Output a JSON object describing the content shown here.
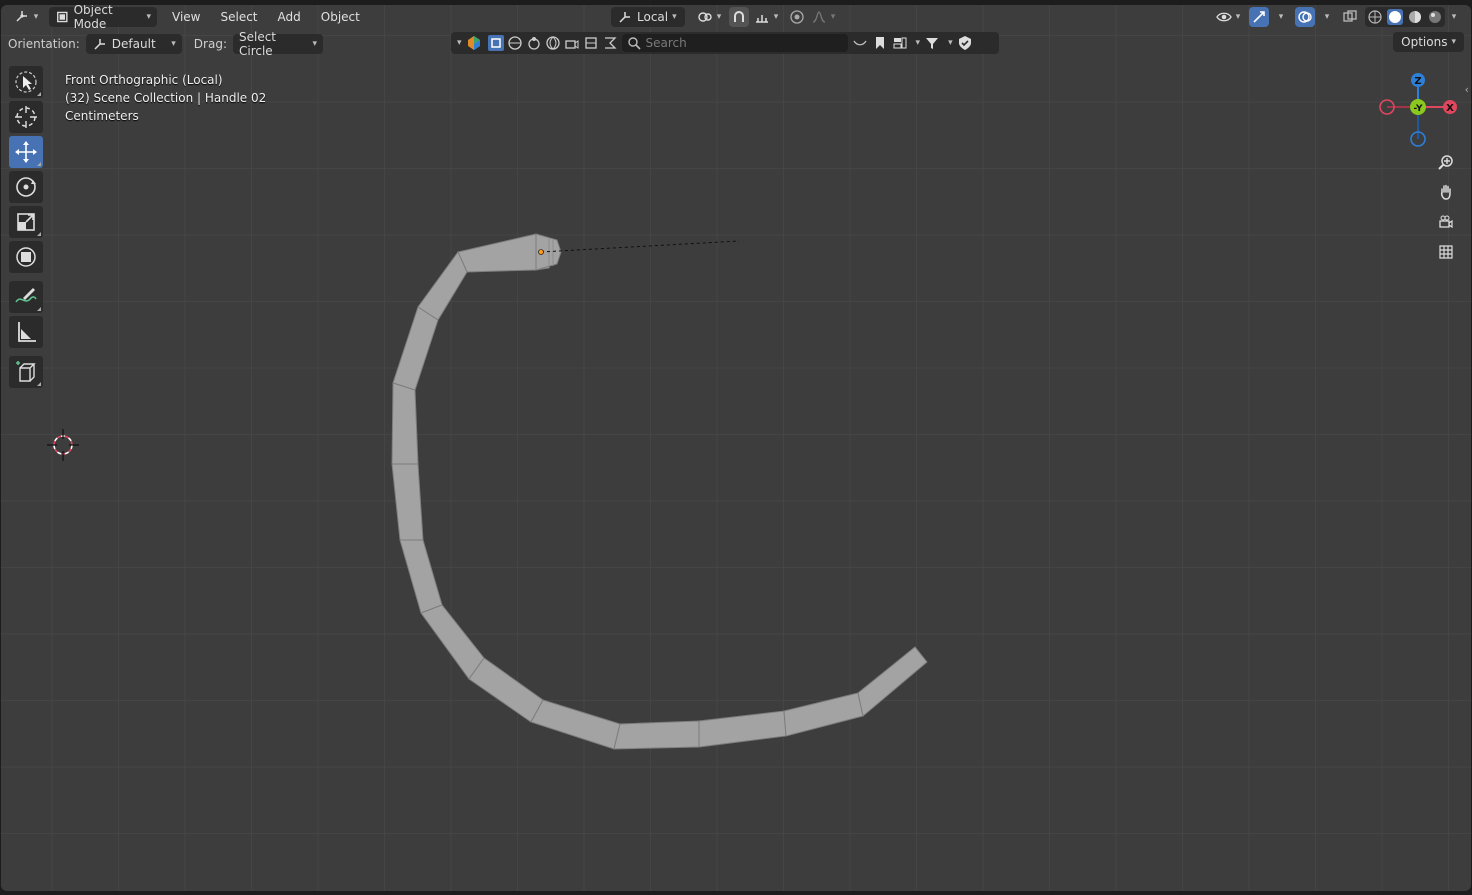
{
  "header": {
    "editor_type_icon": "view3d-icon",
    "mode_label": "Object Mode",
    "menus": [
      "View",
      "Select",
      "Add",
      "Object"
    ],
    "transform_pivot_label": "Local",
    "icons_center": [
      "orientation-icon",
      "pivot-icon",
      "snap-icon",
      "snap-target-icon",
      "proportional-icon",
      "falloff-icon"
    ],
    "icons_right": [
      "visibility-icon",
      "gizmo-icon",
      "overlay-icon",
      "xray-icon",
      "wireframe-shading-icon",
      "solid-shading-icon",
      "material-shading-icon",
      "rendered-shading-icon"
    ]
  },
  "tool_settings": {
    "orientation_label": "Orientation:",
    "orientation_value": "Default",
    "drag_label": "Drag:",
    "drag_value": "Select Circle",
    "search_placeholder": "Search",
    "options_label": "Options"
  },
  "toolbar": {
    "tools": [
      {
        "name": "select-cursor-tool",
        "icon": "select-icon",
        "active": false
      },
      {
        "name": "cursor-tool",
        "icon": "cursor-icon",
        "active": false
      },
      {
        "name": "move-tool",
        "icon": "move-icon",
        "active": true
      },
      {
        "name": "rotate-tool",
        "icon": "rotate-icon",
        "active": false
      },
      {
        "name": "scale-tool",
        "icon": "scale-icon",
        "active": false
      },
      {
        "name": "transform-tool",
        "icon": "transform-icon",
        "active": false
      },
      {
        "name": "annotate-tool",
        "icon": "annotate-icon",
        "active": false
      },
      {
        "name": "measure-tool",
        "icon": "measure-icon",
        "active": false
      },
      {
        "name": "add-cube-tool",
        "icon": "add-cube-icon",
        "active": false
      }
    ]
  },
  "viewport_info": {
    "view_name": "Front Orthographic (Local)",
    "collection": "(32) Scene Collection | Handle 02",
    "units": "Centimeters"
  },
  "gizmo": {
    "axis_z": "Z",
    "axis_y": "-Y",
    "axis_x": "X",
    "colors": {
      "x": "#e0465e",
      "y": "#8ac81f",
      "z": "#2d7fd8"
    }
  },
  "nav_buttons": [
    "zoom-icon",
    "pan-hand-icon",
    "camera-view-icon",
    "ortho-grid-icon"
  ],
  "colors": {
    "viewport_bg": "#3d3d3d",
    "active_tool": "#4772b3",
    "mesh": "#a3a3a3",
    "origin": "#ff9d1a"
  }
}
